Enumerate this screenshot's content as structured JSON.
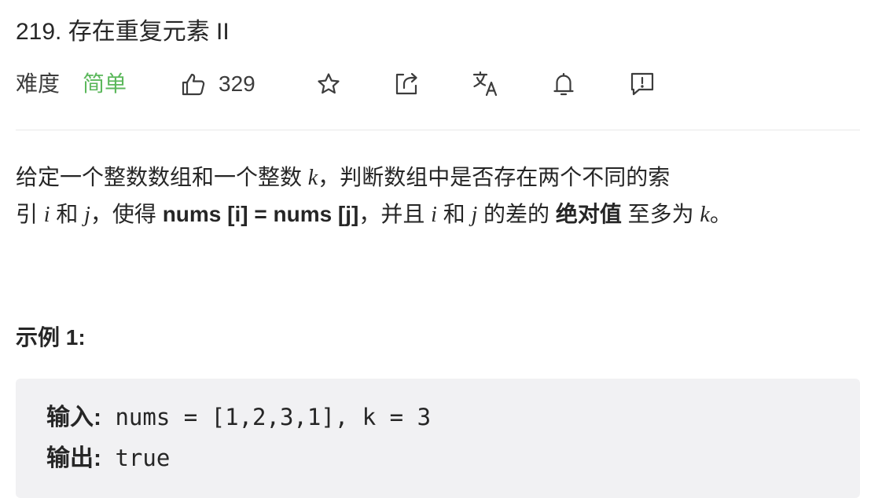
{
  "problem": {
    "title": "219. 存在重复元素 II"
  },
  "toolbar": {
    "difficulty_label": "难度",
    "difficulty_value": "简单",
    "difficulty_color": "#5cb85c",
    "like_count": "329",
    "icons": [
      "thumbs-up-icon",
      "star-icon",
      "share-icon",
      "translate-icon",
      "bell-icon",
      "feedback-icon"
    ]
  },
  "description": {
    "line1_a": "给定一个整数数组和一个整数 ",
    "line1_k": "k",
    "line1_b": "，判断数组中是否存在两个不同的索",
    "line2_a": "引 ",
    "line2_i": "i",
    "line2_b": " 和 ",
    "line2_j": "j",
    "line2_c": "，使得 ",
    "line2_bold1": "nums [i] = nums [j]",
    "line2_d": "，并且 ",
    "line2_i2": "i",
    "line2_e": " 和 ",
    "line2_j2": "j",
    "line2_f": " 的差的 ",
    "line2_bold2": "绝对值",
    "line2_g": " 至多为 ",
    "line2_k": "k",
    "line2_h": "。"
  },
  "example1": {
    "title": "示例 1:",
    "input_label": "输入:",
    "input_value": " nums = [1,2,3,1], k = 3",
    "output_label": "输出:",
    "output_value": " true"
  }
}
